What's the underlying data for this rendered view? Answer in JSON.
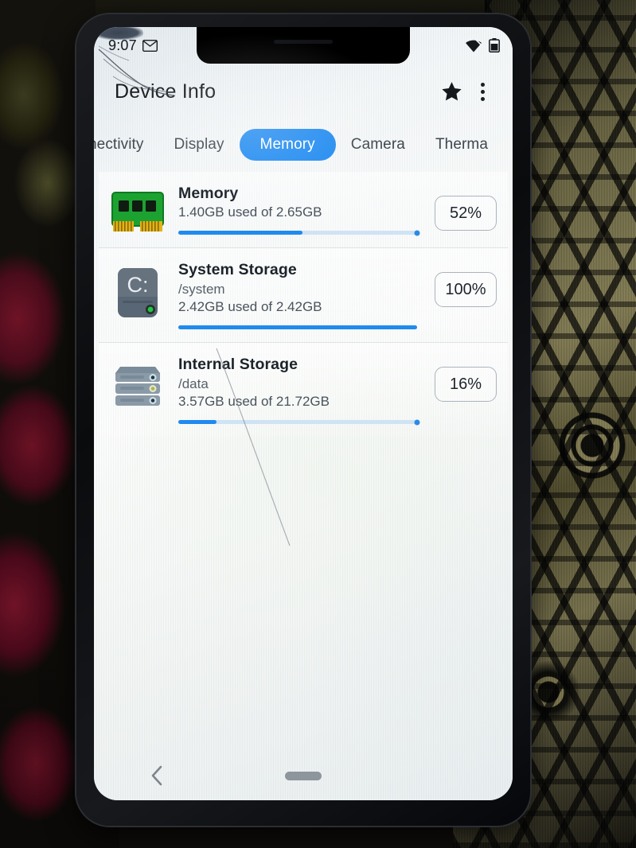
{
  "status_bar": {
    "time": "9:07",
    "notification_icon": "gmail-icon",
    "right_icons": [
      "wifi-icon",
      "battery-icon"
    ]
  },
  "app_bar": {
    "title": "Device Info",
    "favorite_icon": "star-icon",
    "overflow_icon": "more-vertical-icon"
  },
  "tabs": {
    "items": [
      {
        "label": "nectivity",
        "selected": false,
        "clipped": true
      },
      {
        "label": "Display",
        "selected": false,
        "clipped": false
      },
      {
        "label": "Memory",
        "selected": true,
        "clipped": false
      },
      {
        "label": "Camera",
        "selected": false,
        "clipped": false
      },
      {
        "label": "Therma",
        "selected": false,
        "clipped": true
      }
    ],
    "selected_color": "#1f8af0"
  },
  "list": {
    "items": [
      {
        "icon": "ram-module-icon",
        "title": "Memory",
        "path": "",
        "usage": "1.40GB used of 2.65GB",
        "percent_label": "52%",
        "percent_value": 52
      },
      {
        "icon": "hard-drive-c-icon",
        "title": "System Storage",
        "path": "/system",
        "usage": "2.42GB used of 2.42GB",
        "percent_label": "100%",
        "percent_value": 100
      },
      {
        "icon": "storage-stack-icon",
        "title": "Internal Storage",
        "path": "/data",
        "usage": "3.57GB used of 21.72GB",
        "percent_label": "16%",
        "percent_value": 16
      }
    ]
  },
  "nav_bar": {
    "back_icon": "chevron-left-icon",
    "home_icon": "home-pill-icon"
  },
  "colors": {
    "accent": "#1f8af0",
    "track": "#cfe3f4",
    "text_primary": "#1c232a",
    "text_secondary": "#576069"
  }
}
